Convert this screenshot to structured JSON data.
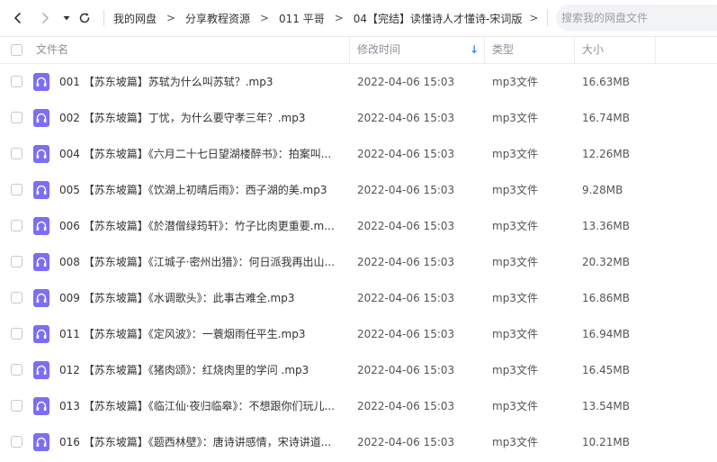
{
  "nav": {
    "breadcrumb": [
      "我的网盘",
      "分享教程资源",
      "011 平哥",
      "04【完结】读懂诗人才懂诗-宋词版"
    ],
    "separator": ">",
    "search_placeholder": "搜索我的网盘文件"
  },
  "table": {
    "headers": {
      "name": "文件名",
      "modified": "修改时间",
      "type": "类型",
      "size": "大小"
    },
    "sort_indicator": "↓",
    "rows": [
      {
        "name": "001 【苏东坡篇】苏轼为什么叫苏轼？.mp3",
        "time": "2022-04-06 15:03",
        "type": "mp3文件",
        "size": "16.63MB"
      },
      {
        "name": "002 【苏东坡篇】丁忧，为什么要守孝三年？.mp3",
        "time": "2022-04-06 15:03",
        "type": "mp3文件",
        "size": "16.74MB"
      },
      {
        "name": "004 【苏东坡篇】《六月二十七日望湖楼醉书》：拍案叫...",
        "time": "2022-04-06 15:03",
        "type": "mp3文件",
        "size": "12.26MB"
      },
      {
        "name": "005 【苏东坡篇】《饮湖上初晴后雨》：西子湖的美.mp3",
        "time": "2022-04-06 15:03",
        "type": "mp3文件",
        "size": "9.28MB"
      },
      {
        "name": "006 【苏东坡篇】《於潜僧绿筠轩》：竹子比肉更重要.m...",
        "time": "2022-04-06 15:03",
        "type": "mp3文件",
        "size": "13.36MB"
      },
      {
        "name": "008 【苏东坡篇】《江城子·密州出猎》：何日派我再出山...",
        "time": "2022-04-06 15:03",
        "type": "mp3文件",
        "size": "20.32MB"
      },
      {
        "name": "009 【苏东坡篇】《水调歌头》：此事古难全.mp3",
        "time": "2022-04-06 15:03",
        "type": "mp3文件",
        "size": "16.86MB"
      },
      {
        "name": "011 【苏东坡篇】《定风波》：一蓑烟雨任平生.mp3",
        "time": "2022-04-06 15:03",
        "type": "mp3文件",
        "size": "16.94MB"
      },
      {
        "name": "012 【苏东坡篇】《猪肉颂》：红烧肉里的学问 .mp3",
        "time": "2022-04-06 15:03",
        "type": "mp3文件",
        "size": "16.45MB"
      },
      {
        "name": "013 【苏东坡篇】《临江仙·夜归临皋》：不想跟你们玩儿...",
        "time": "2022-04-06 15:03",
        "type": "mp3文件",
        "size": "13.54MB"
      },
      {
        "name": "016 【苏东坡篇】《题西林壁》：唐诗讲感情，宋诗讲道...",
        "time": "2022-04-06 15:03",
        "type": "mp3文件",
        "size": "10.21MB"
      }
    ]
  },
  "colors": {
    "audio_icon": "#7b6ef6",
    "sort_arrow": "#3b8cff"
  },
  "icons": {
    "back": "arrow-left-icon",
    "forward": "arrow-right-icon",
    "dropdown": "caret-down-icon",
    "refresh": "refresh-icon",
    "file": "audio-file-icon"
  }
}
